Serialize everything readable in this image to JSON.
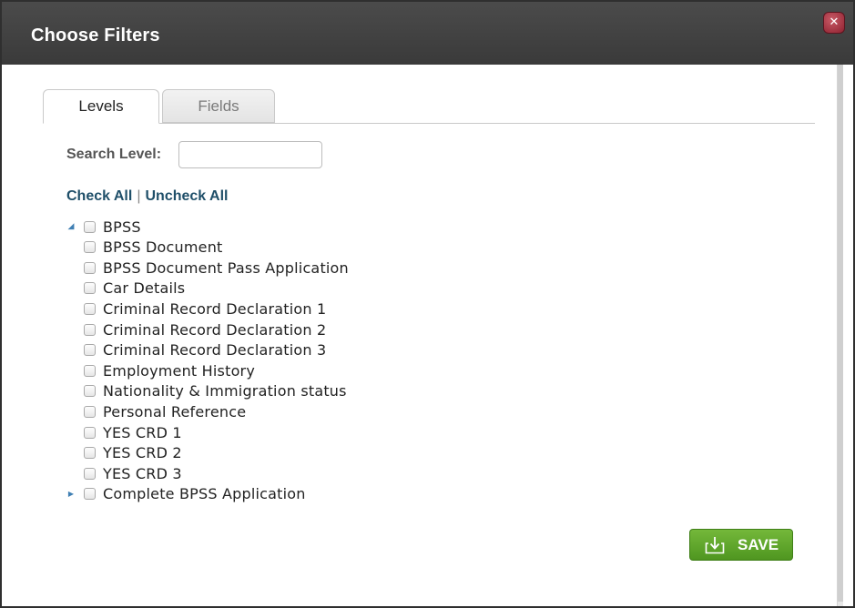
{
  "dialog": {
    "title": "Choose Filters",
    "close_symbol": "✕",
    "close_icon": "close-icon"
  },
  "tabs": [
    {
      "label": "Levels",
      "active": true
    },
    {
      "label": "Fields",
      "active": false
    }
  ],
  "search": {
    "label": "Search Level:",
    "value": "",
    "placeholder": ""
  },
  "check_links": {
    "check_all": "Check All",
    "separator": "|",
    "uncheck_all": "Uncheck All"
  },
  "tree": {
    "expanded_arrow": "◢",
    "collapsed_arrow": "▶",
    "items": [
      {
        "label": "BPSS",
        "level": 0,
        "expander": "expanded",
        "checked": false
      },
      {
        "label": "BPSS Document",
        "level": 1,
        "checked": false
      },
      {
        "label": "BPSS Document Pass Application",
        "level": 1,
        "checked": false
      },
      {
        "label": "Car Details",
        "level": 1,
        "checked": false
      },
      {
        "label": "Criminal Record Declaration 1",
        "level": 1,
        "checked": false
      },
      {
        "label": "Criminal Record Declaration 2",
        "level": 1,
        "checked": false
      },
      {
        "label": "Criminal Record Declaration 3",
        "level": 1,
        "checked": false
      },
      {
        "label": "Employment History",
        "level": 1,
        "checked": false
      },
      {
        "label": "Nationality & Immigration status",
        "level": 1,
        "checked": false
      },
      {
        "label": "Personal Reference",
        "level": 1,
        "checked": false
      },
      {
        "label": "YES CRD 1",
        "level": 1,
        "checked": false
      },
      {
        "label": "YES CRD 2",
        "level": 1,
        "checked": false
      },
      {
        "label": "YES CRD 3",
        "level": 1,
        "checked": false
      },
      {
        "label": "Complete BPSS Application",
        "level": 0,
        "expander": "collapsed",
        "checked": false
      }
    ]
  },
  "footer": {
    "save_label": "SAVE",
    "save_icon": "save-icon"
  },
  "colors": {
    "titlebar": "#3f3f3f",
    "link": "#1f4f69",
    "save_button": "#5ea52b",
    "close_button": "#a83443",
    "tree_arrow": "#3f7fb3"
  }
}
